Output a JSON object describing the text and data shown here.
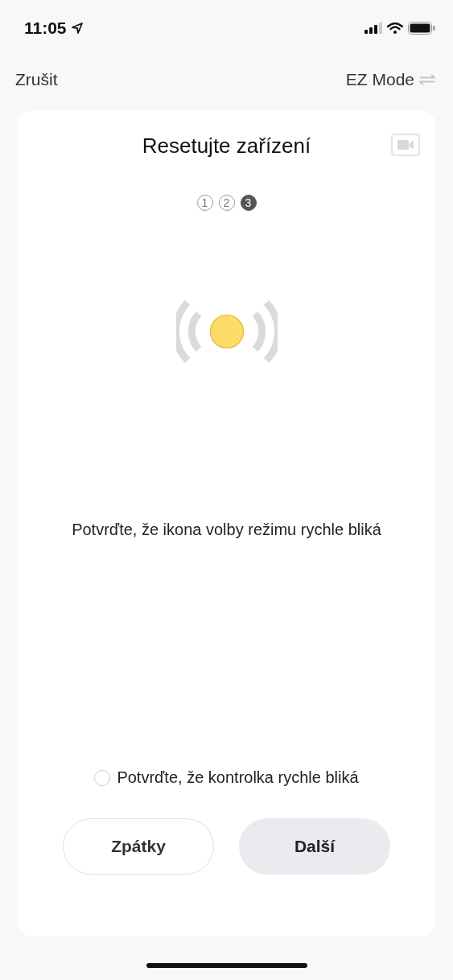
{
  "status_bar": {
    "time": "11:05"
  },
  "nav": {
    "cancel": "Zrušit",
    "mode": "EZ Mode"
  },
  "card": {
    "title": "Resetujte zařízení",
    "steps": [
      {
        "label": "1",
        "selected": false
      },
      {
        "label": "2",
        "selected": false
      },
      {
        "label": "3",
        "selected": true
      }
    ],
    "instruction": "Potvrďte, že ikona volby režimu rychle bliká",
    "confirm": {
      "label": "Potvrďte, že kontrolka rychle bliká",
      "checked": false
    },
    "buttons": [
      {
        "label": "Zpátky",
        "kind": "secondary"
      },
      {
        "label": "Další",
        "kind": "primary"
      }
    ]
  }
}
